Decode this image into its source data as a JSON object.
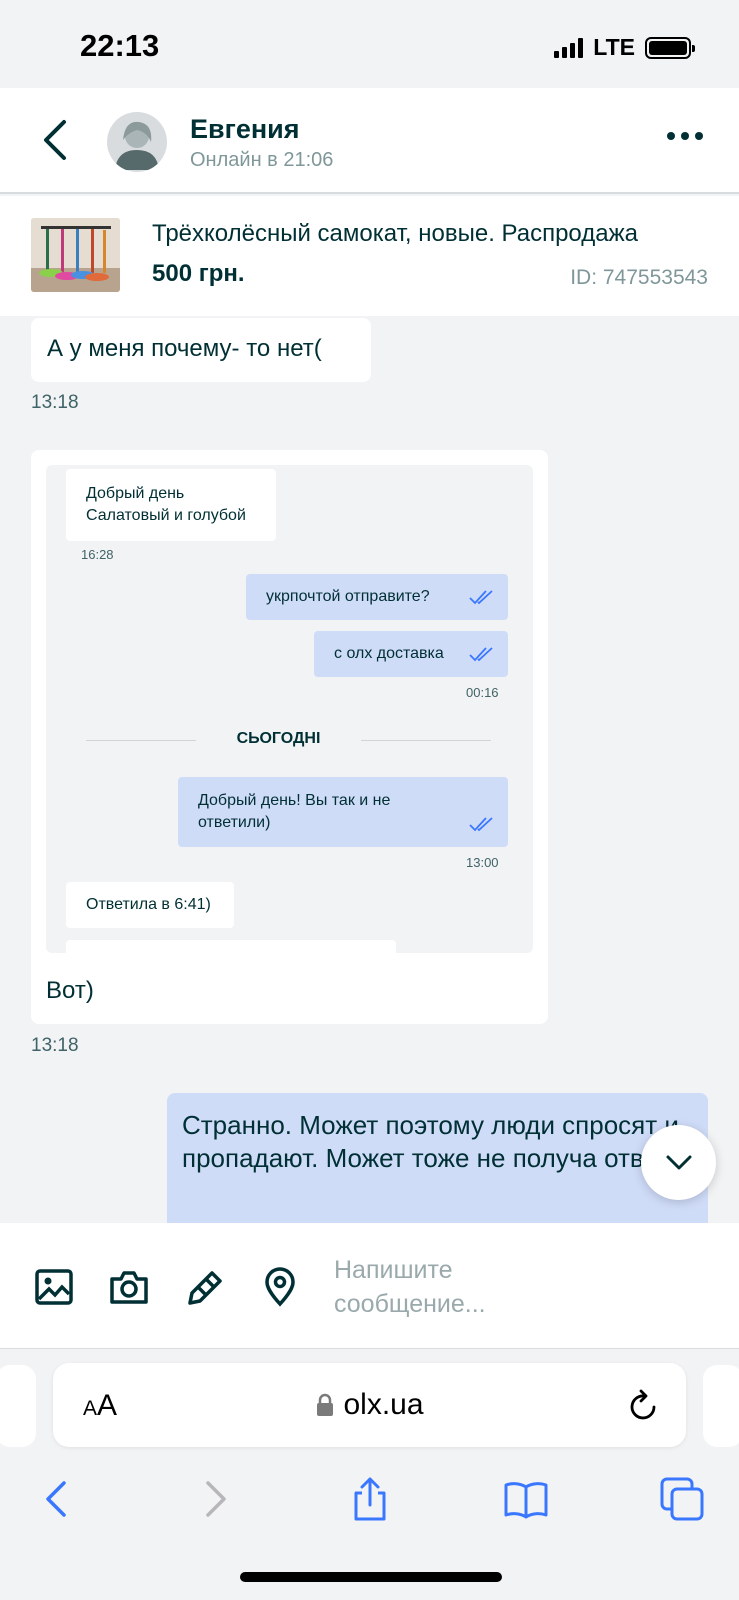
{
  "status_bar": {
    "time": "22:13",
    "network": "LTE"
  },
  "header": {
    "contact_name": "Евгения",
    "contact_status": "Онлайн в 21:06"
  },
  "ad": {
    "title": "Трёхколёсный самокат, новые. Распродажа",
    "price": "500 грн.",
    "id": "ID: 747553543"
  },
  "messages": [
    {
      "direction": "in",
      "text": "А у меня почему- то нет(",
      "time": "13:18"
    },
    {
      "direction": "in",
      "text": "Вот)",
      "time": "13:18"
    },
    {
      "direction": "out",
      "text": "Странно. Может поэтому люди спросят и пропадают. Может тоже не получа ответ"
    }
  ],
  "embedded_screenshot": {
    "msg1": "Добрый день\nСалатовый и голубой",
    "msg1_time": "16:28",
    "msg2": "укрпочтой отправите?",
    "msg3": "с олх доставка",
    "msg3_time": "00:16",
    "divider": "СЬОГОДНІ",
    "msg4": "Добрый день! Вы так и не ответили)",
    "msg4_time": "13:00",
    "msg5": "Ответила в 6:41)"
  },
  "composer": {
    "placeholder": "Напишите сообщение..."
  },
  "browser": {
    "aa_small": "A",
    "aa_large": "A",
    "url": "olx.ua"
  },
  "colors": {
    "accent": "#3a77ff",
    "outgoing_bubble": "#cfdcf8",
    "text": "#002f34",
    "muted": "#7f9799"
  },
  "icons": [
    "back-icon",
    "avatar-icon",
    "more-icon",
    "image-icon",
    "camera-icon",
    "attach-icon",
    "location-icon",
    "chevron-down-icon",
    "lock-icon",
    "reload-icon",
    "share-icon",
    "bookmarks-icon",
    "tabs-icon"
  ]
}
